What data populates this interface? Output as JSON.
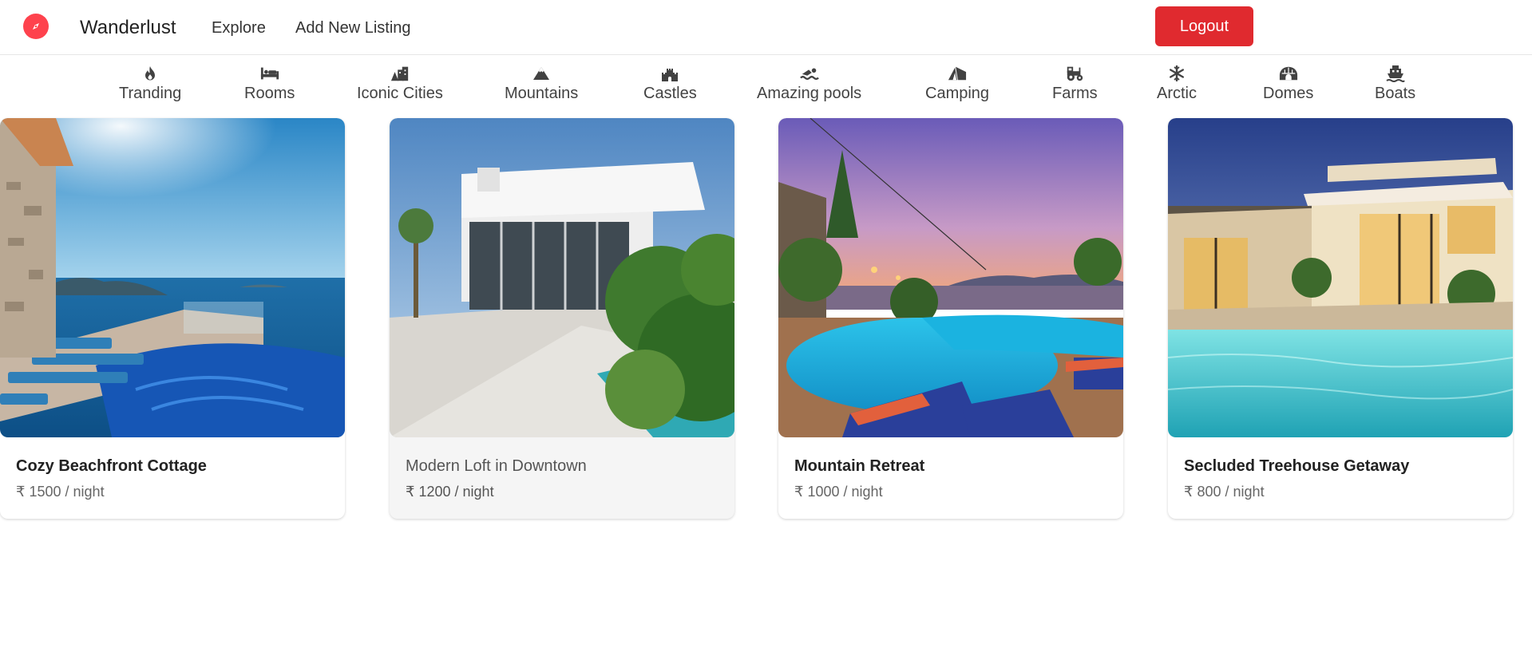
{
  "brand": {
    "name": "Wanderlust",
    "logo_icon": "compass-icon",
    "accent": "#fe424d"
  },
  "nav": {
    "explore": "Explore",
    "add_listing": "Add New Listing",
    "logout": "Logout",
    "logout_color": "#e02a2f"
  },
  "filters": [
    {
      "label": "Tranding",
      "icon": "fire-icon"
    },
    {
      "label": "Rooms",
      "icon": "bed-icon"
    },
    {
      "label": "Iconic Cities",
      "icon": "city-icon"
    },
    {
      "label": "Mountains",
      "icon": "mountain-icon"
    },
    {
      "label": "Castles",
      "icon": "castle-icon"
    },
    {
      "label": "Amazing pools",
      "icon": "swimmer-icon"
    },
    {
      "label": "Camping",
      "icon": "tent-icon"
    },
    {
      "label": "Farms",
      "icon": "tractor-icon"
    },
    {
      "label": "Arctic",
      "icon": "snowflake-icon"
    },
    {
      "label": "Domes",
      "icon": "igloo-icon"
    },
    {
      "label": "Boats",
      "icon": "ferry-icon"
    }
  ],
  "listings": [
    {
      "title": "Cozy Beachfront Cottage",
      "currency": "₹",
      "price": "1500",
      "unit": "/ night"
    },
    {
      "title": "Modern Loft in Downtown",
      "currency": "₹",
      "price": "1200",
      "unit": "/ night"
    },
    {
      "title": "Mountain Retreat",
      "currency": "₹",
      "price": "1000",
      "unit": "/ night"
    },
    {
      "title": "Secluded Treehouse Getaway",
      "currency": "₹",
      "price": "800",
      "unit": "/ night"
    }
  ]
}
